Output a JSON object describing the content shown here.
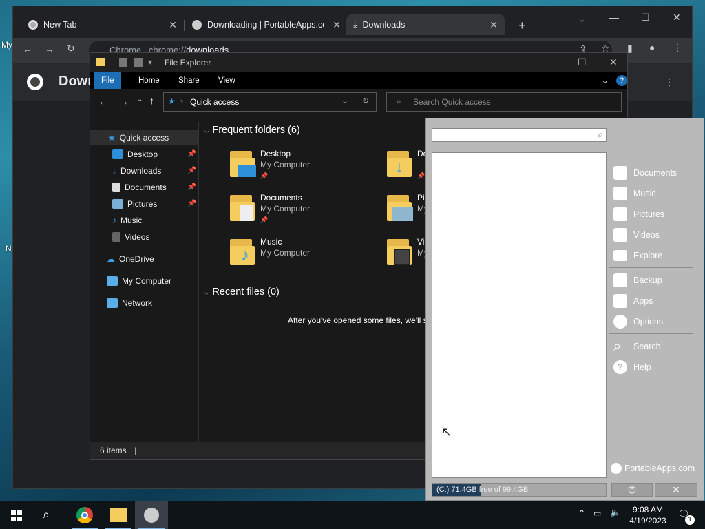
{
  "desktop": {
    "frag1": "My",
    "frag2": "N"
  },
  "chrome": {
    "tabs": [
      {
        "label": "New Tab"
      },
      {
        "label": "Downloading | PortableApps.com"
      },
      {
        "label": "Downloads"
      }
    ],
    "url_scheme": "chrome://",
    "url_path": "downloads",
    "url_prefix": "Chrome",
    "page_title": "Downloads"
  },
  "explorer": {
    "title": "File Explorer",
    "ribbon_tabs": [
      "File",
      "Home",
      "Share",
      "View"
    ],
    "address": "Quick access",
    "search_placeholder": "Search Quick access",
    "nav": {
      "quick_access": "Quick access",
      "pinned": [
        "Desktop",
        "Downloads",
        "Documents",
        "Pictures"
      ],
      "unpinned": [
        "Music",
        "Videos"
      ],
      "onedrive": "OneDrive",
      "my_computer": "My Computer",
      "network": "Network"
    },
    "frequent_header": "Frequent folders (6)",
    "folders": [
      {
        "name": "Desktop",
        "location": "My Computer"
      },
      {
        "name": "Documents",
        "location": "My Computer"
      },
      {
        "name": "Music",
        "location": "My Computer"
      },
      {
        "name": "Do",
        "location": "My"
      },
      {
        "name": "Pi",
        "location": "My"
      },
      {
        "name": "Vi",
        "location": "My"
      }
    ],
    "recent_header": "Recent files (0)",
    "recent_empty": "After you've opened some files, we'll s",
    "status": "6 items"
  },
  "portableapps": {
    "menu": [
      "Documents",
      "Music",
      "Pictures",
      "Videos",
      "Explore",
      "Backup",
      "Apps",
      "Options",
      "Search",
      "Help"
    ],
    "brand": "PortableApps.com",
    "disk_label": "(C:) 71.4GB free of 99.4GB",
    "disk_used_fraction": 0.28
  },
  "taskbar": {
    "time": "9:08 AM",
    "date": "4/19/2023",
    "notifications": "1"
  },
  "colors": {
    "accent": "#1c6fb5",
    "folder": "#f4cd5e",
    "chrome_bg": "#202124"
  }
}
